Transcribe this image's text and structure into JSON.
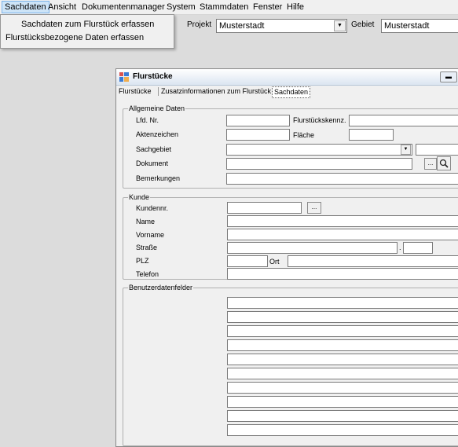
{
  "menubar": {
    "items": [
      {
        "label": "Sachdaten"
      },
      {
        "label": "Ansicht"
      },
      {
        "label": "Dokumentenmanager"
      },
      {
        "label": "System"
      },
      {
        "label": "Stammdaten"
      },
      {
        "label": "Fenster"
      },
      {
        "label": "Hilfe"
      }
    ]
  },
  "dropdown": {
    "items": [
      {
        "label": "Sachdaten zum Flurstück erfassen"
      },
      {
        "label": "Flurstücksbezogene Daten erfassen"
      }
    ]
  },
  "toolbar": {
    "projekt_label": "Projekt",
    "projekt_value": "Musterstadt",
    "gebiet_label": "Gebiet",
    "gebiet_value": "Musterstadt"
  },
  "window": {
    "title": "Flurstücke",
    "tabs": [
      {
        "label": "Flurstücke"
      },
      {
        "label": "Zusatzinformationen zum Flurstück"
      },
      {
        "label": "Sachdaten"
      }
    ],
    "active_tab": "Sachdaten"
  },
  "general": {
    "title": "Allgemeine Daten",
    "lfd_nr": "Lfd. Nr.",
    "flurstueckskennz": "Flurstückskennz.",
    "aktenzeichen": "Aktenzeichen",
    "flaeche": "Fläche",
    "sachgebiet": "Sachgebiet",
    "dokument": "Dokument",
    "bemerkungen": "Bemerkungen",
    "browse_label": "..."
  },
  "kunde": {
    "title": "Kunde",
    "kundennr": "Kundennr.",
    "name": "Name",
    "vorname": "Vorname",
    "strasse": "Straße",
    "plz": "PLZ",
    "ort": "Ort",
    "telefon": "Telefon",
    "browse_label": "...",
    "street_sep": "."
  },
  "benutzer": {
    "title": "Benutzerdatenfelder"
  },
  "colors": {
    "menu_bg": "#f0f0f0",
    "highlight": "#cde4f7",
    "window_bg": "#f0f0f0"
  }
}
